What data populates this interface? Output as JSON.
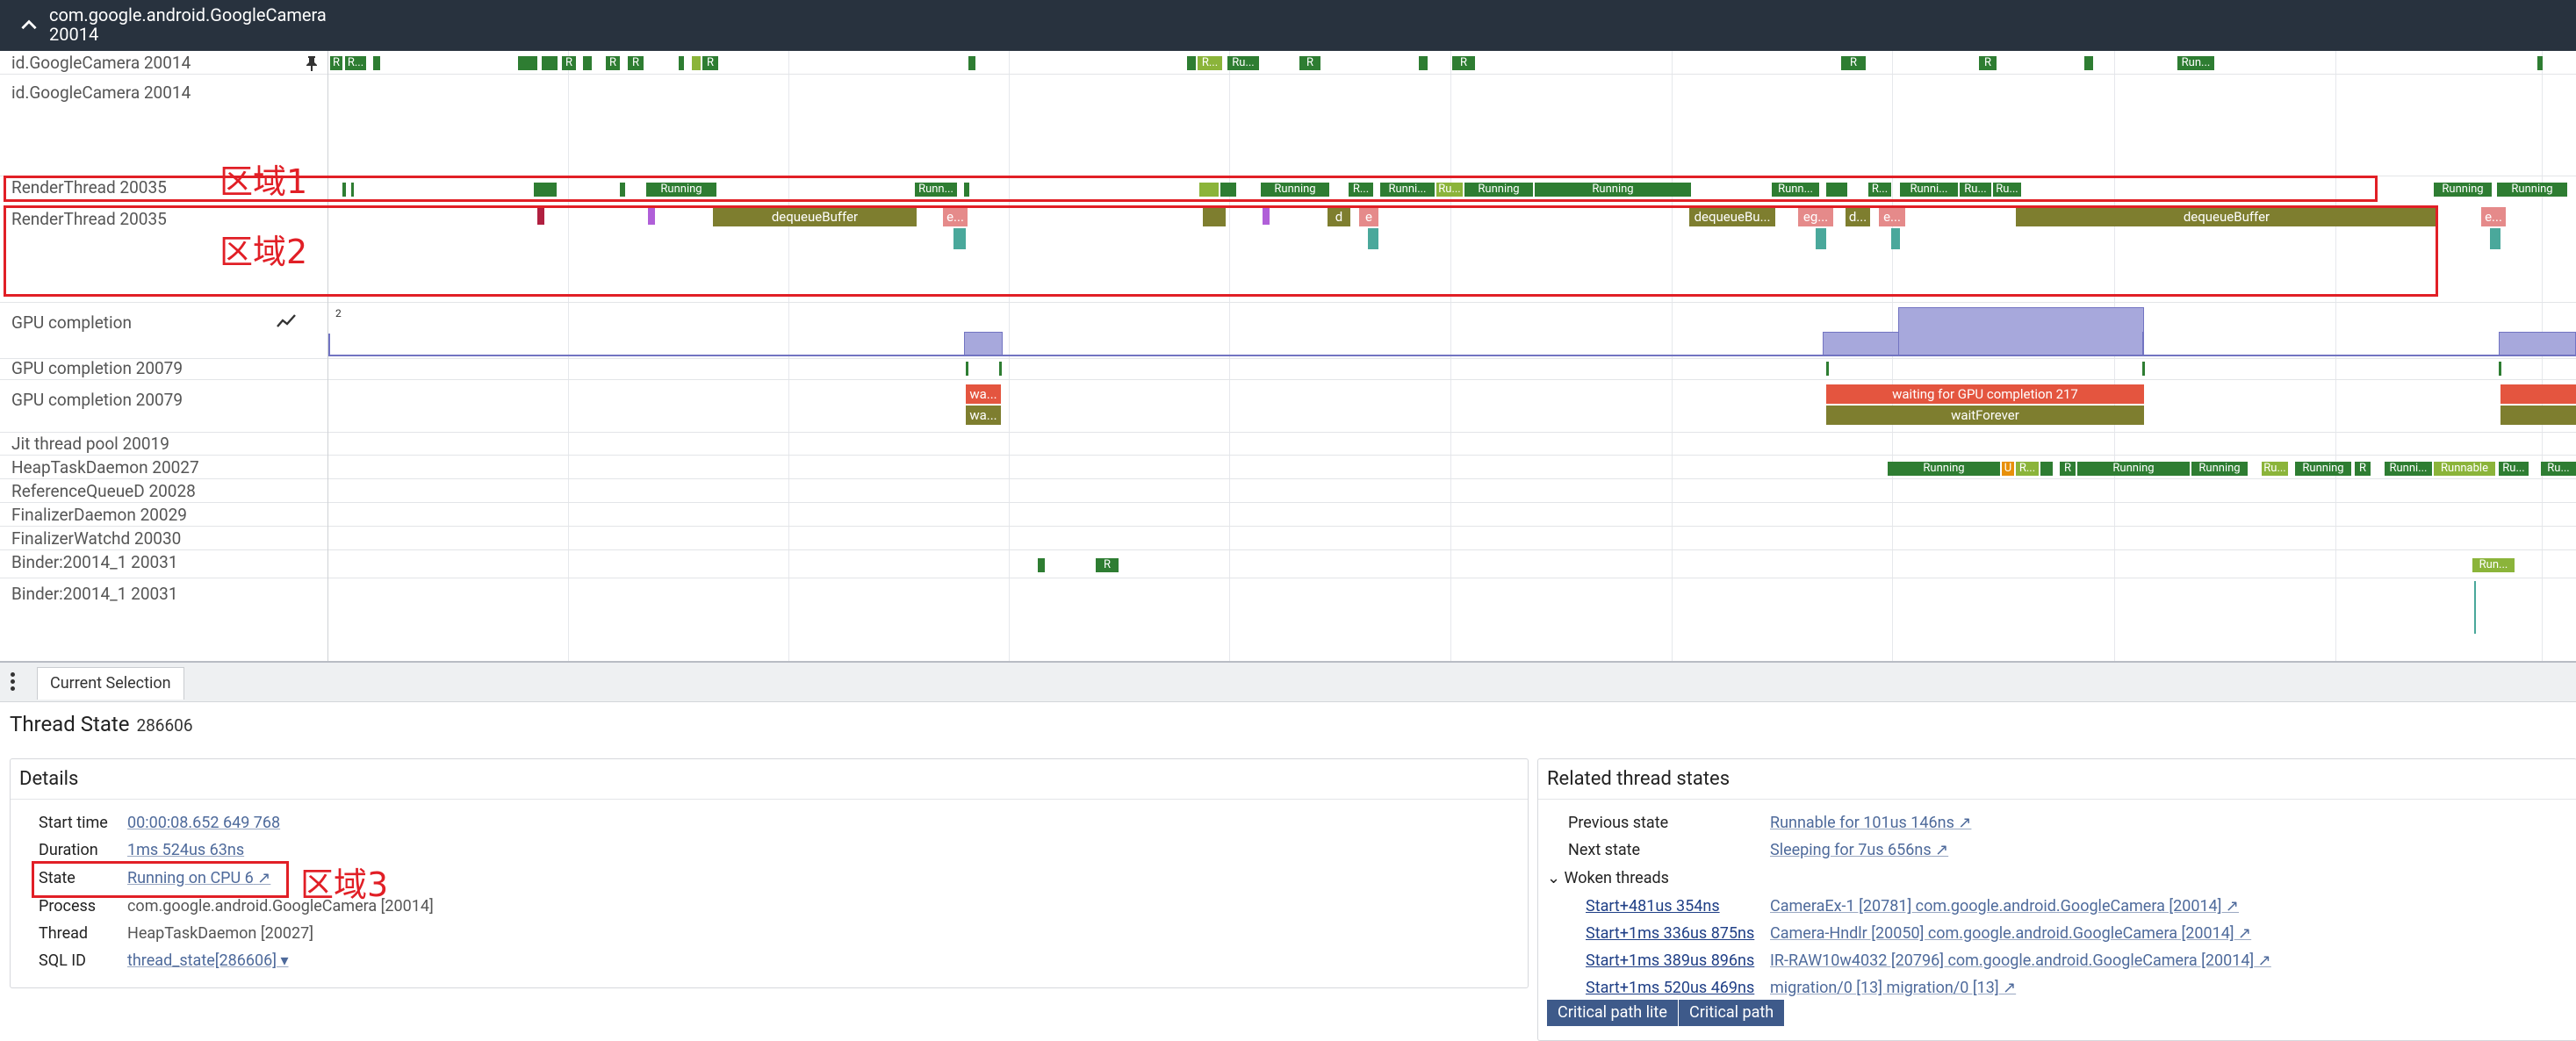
{
  "header": {
    "title": "com.google.android.GoogleCamera 20014"
  },
  "tracks": {
    "labels": {
      "gc1": "id.GoogleCamera 20014",
      "gc2": "id.GoogleCamera 20014",
      "rt1": "RenderThread 20035",
      "rt2": "RenderThread 20035",
      "gpu": "GPU completion",
      "gpu79a": "GPU completion 20079",
      "gpu79b": "GPU completion 20079",
      "jit": "Jit thread pool 20019",
      "heap": "HeapTaskDaemon 20027",
      "refq": "ReferenceQueueD 20028",
      "fin": "FinalizerDaemon 20029",
      "finw": "FinalizerWatchd 20030",
      "binder1": "Binder:20014_1 20031",
      "binder2": "Binder:20014_1 20031"
    },
    "gpu_scale": "2",
    "slices": {
      "r": "R",
      "rdots": "R...",
      "ru": "Ru...",
      "running": "Running",
      "runn": "Runn...",
      "runni": "Runni...",
      "d": "d",
      "e": "e",
      "edots": "e...",
      "eg": "eg...",
      "ddots": "d...",
      "deq": "dequeueBuffer",
      "deqbu": "dequeueBu...",
      "wa": "wa...",
      "waitgpu": "waiting for GPU completion 217",
      "waitforever": "waitForever",
      "u": "U",
      "runnable": "Runnable",
      "run": "Run..."
    }
  },
  "annotations": {
    "region1": "区域1",
    "region2": "区域2",
    "region3": "区域3"
  },
  "panel": {
    "tab": "Current Selection",
    "title": "Thread State",
    "id": "286606",
    "details": {
      "heading": "Details",
      "rows": [
        {
          "label": "Start time",
          "value": "00:00:08.652 649 768"
        },
        {
          "label": "Duration",
          "value": "1ms 524us 63ns"
        },
        {
          "label": "State",
          "value": "Running on CPU 6"
        },
        {
          "label": "Process",
          "value": "com.google.android.GoogleCamera [20014]"
        },
        {
          "label": "Thread",
          "value": "HeapTaskDaemon [20027]"
        },
        {
          "label": "SQL ID",
          "value": "thread_state[286606]"
        }
      ]
    },
    "related": {
      "heading": "Related thread states",
      "previous_label": "Previous state",
      "previous_value": "Runnable for 101us 146ns",
      "next_label": "Next state",
      "next_value": "Sleeping for 7us 656ns",
      "woken_label": "Woken threads",
      "woken": [
        {
          "start": "Start+481us 354ns",
          "thread": "CameraEx-1 [20781] com.google.android.GoogleCamera [20014]"
        },
        {
          "start": "Start+1ms 336us 875ns",
          "thread": "Camera-Hndlr [20050] com.google.android.GoogleCamera [20014]"
        },
        {
          "start": "Start+1ms 389us 896ns",
          "thread": "IR-RAW10w4032 [20796] com.google.android.GoogleCamera [20014]"
        },
        {
          "start": "Start+1ms 520us 469ns",
          "thread": "migration/0 [13] migration/0 [13]"
        }
      ],
      "buttons": {
        "lite": "Critical path lite",
        "full": "Critical path"
      }
    }
  }
}
